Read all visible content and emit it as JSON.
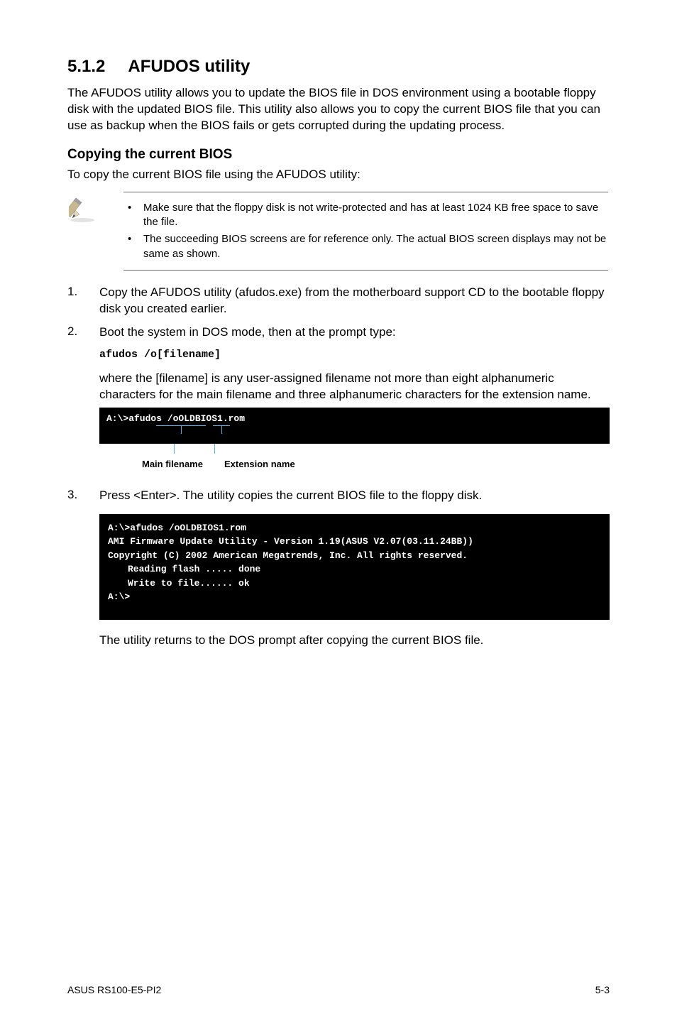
{
  "heading": {
    "number": "5.1.2",
    "title": "AFUDOS utility"
  },
  "intro": "The AFUDOS utility allows you to update the BIOS file in DOS environment using a bootable floppy disk with the updated BIOS file. This utility also allows you to copy the current BIOS file that you can use as backup when the BIOS fails or gets corrupted during the updating process.",
  "sub1": {
    "title": "Copying the current BIOS",
    "lead": "To copy the current BIOS file using the AFUDOS utility:"
  },
  "notes": [
    "Make sure that the floppy disk is not write-protected and has at least 1024 KB free space to save the file.",
    "The succeeding BIOS screens are for reference only. The actual BIOS screen displays may not be same as shown."
  ],
  "steps": [
    {
      "num": "1.",
      "text": "Copy the AFUDOS utility (afudos.exe) from the motherboard support CD to the bootable floppy disk you created earlier."
    },
    {
      "num": "2.",
      "text": "Boot the system in DOS mode, then at the prompt type:"
    }
  ],
  "code_cmd": "afudos /o[filename]",
  "step2_tail": "where the [filename] is any user-assigned filename not more than eight alphanumeric characters for the main filename and three alphanumeric characters for the extension name.",
  "terminal1": {
    "line": "A:\\>afudos /oOLDBIOS1.rom"
  },
  "anno": {
    "label1": "Main filename",
    "label2": "Extension name"
  },
  "step3": {
    "num": "3.",
    "text": "Press <Enter>. The utility copies the current BIOS file to the floppy disk."
  },
  "terminal2": {
    "l1": "A:\\>afudos /oOLDBIOS1.rom",
    "l2": "AMI Firmware Update Utility - Version 1.19(ASUS V2.07(03.11.24BB))",
    "l3": "Copyright (C) 2002 American Megatrends, Inc. All rights reserved.",
    "l4": "Reading flash ..... done",
    "l5": "Write to file...... ok",
    "l6": "A:\\>"
  },
  "tail_text": "The utility returns to the DOS prompt after copying the current BIOS file.",
  "footer": {
    "left": "ASUS RS100-E5-PI2",
    "right": "5-3"
  }
}
